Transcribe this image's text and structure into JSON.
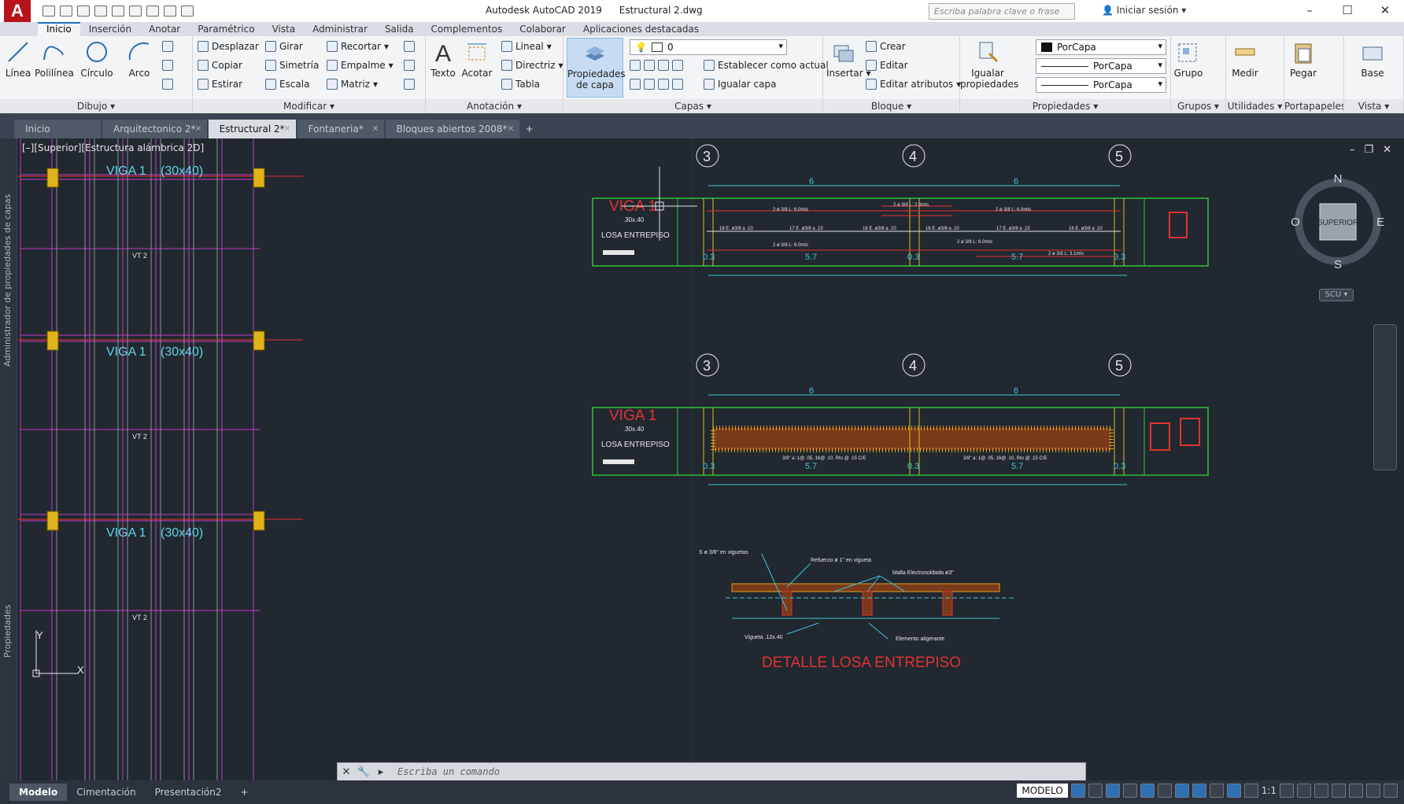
{
  "app": {
    "logo": "A",
    "product": "Autodesk AutoCAD 2019",
    "document": "Estructural 2.dwg",
    "search_placeholder": "Escriba palabra clave o frase",
    "sign_in": "Iniciar sesión",
    "window_controls": [
      "–",
      "☐",
      "✕"
    ]
  },
  "ribbon_tabs": [
    "Inicio",
    "Inserción",
    "Anotar",
    "Paramétrico",
    "Vista",
    "Administrar",
    "Salida",
    "Complementos",
    "Colaborar",
    "Aplicaciones destacadas"
  ],
  "ribbon": {
    "dibujo": {
      "title": "Dibujo",
      "linea": "Línea",
      "polilinea": "Polilínea",
      "circulo": "Círculo",
      "arco": "Arco"
    },
    "modificar": {
      "title": "Modificar",
      "desplazar": "Desplazar",
      "girar": "Girar",
      "recortar": "Recortar",
      "copiar": "Copiar",
      "simetria": "Simetría",
      "empalme": "Empalme",
      "estirar": "Estirar",
      "escala": "Escala",
      "matriz": "Matriz"
    },
    "anotacion": {
      "title": "Anotación",
      "texto": "Texto",
      "acotar": "Acotar",
      "lineal": "Lineal",
      "directriz": "Directriz",
      "tabla": "Tabla"
    },
    "capas": {
      "title": "Capas",
      "propiedades_1": "Propiedades",
      "propiedades_2": "de capa",
      "layer_current": "0",
      "establecer": "Establecer como actual",
      "igualar": "Igualar capa"
    },
    "bloque": {
      "title": "Bloque",
      "insertar": "Insertar",
      "crear": "Crear",
      "editar": "Editar",
      "editar_atributos": "Editar atributos"
    },
    "propiedades": {
      "title": "Propiedades",
      "igualar_1": "Igualar",
      "igualar_2": "propiedades",
      "color": "PorCapa",
      "linetype": "PorCapa",
      "lineweight": "PorCapa"
    },
    "grupos": {
      "title": "Grupos",
      "grupo": "Grupo"
    },
    "utilidades": {
      "title": "Utilidades",
      "medir": "Medir"
    },
    "portapapeles": {
      "title": "Portapapeles",
      "pegar": "Pegar"
    },
    "vista": {
      "title": "Vista",
      "base": "Base"
    }
  },
  "file_tabs": [
    {
      "label": "Inicio"
    },
    {
      "label": "Arquitectonico 2*"
    },
    {
      "label": "Estructural 2*"
    },
    {
      "label": "Fontaneria*"
    },
    {
      "label": "Bloques abiertos 2008*"
    }
  ],
  "viewport": {
    "label": "[–][Superior][Estructura alámbrica 2D]",
    "side_palettes": [
      "Administrador de propiedades de capas",
      "Propiedades"
    ],
    "controls": [
      "–",
      "❐",
      "✕"
    ]
  },
  "drawing": {
    "plan_beam_label": "VIGA 1",
    "plan_beam_size": "(30x40)",
    "plan_vt": "VT 2",
    "axes": [
      "3",
      "4",
      "5"
    ],
    "span_labels": [
      "6",
      "6"
    ],
    "bottom_dims": [
      "0.3",
      "5.7",
      "0.3",
      "5.7",
      "0.3"
    ],
    "beam_title": "VIGA 1",
    "beam_size": ".30x.40",
    "losa": "LOSA ENTREPISO",
    "bar_top": "2 ø 3/8  L: 6.0mts",
    "bar_top_center": "2 ø 3/8  L: 2.0mts",
    "bar_bottom": "2 ø 3/8  L: 6.0mts",
    "bar_end": "2 ø 3/8  L: 3.1mts",
    "stirrups_1": "16 E. ø3/8  a .10",
    "stirrups_2": "17 E. ø3/8  a .15",
    "stirrups_3": "16 E. ø3/8  a .10",
    "stirrup_spec": "3/8\" a: 1@ .05, 16@ .10, Rto @ .15  C/E",
    "detail_title": "DETALLE LOSA ENTREPISO",
    "detail_notes": [
      "S ø 3/8\" en viguetas",
      "Refuerzo ø 1\" en vigueta",
      "Malla Electrosoldada ø3\"",
      "Vigueta .12x.40",
      "Elemento aligerante"
    ]
  },
  "viewcube": {
    "north": "N",
    "south": "S",
    "east": "E",
    "west": "O",
    "face": "SUPERIOR",
    "ucs": "SCU"
  },
  "command_line": {
    "placeholder": "Escriba un comando"
  },
  "layout_tabs": [
    "Modelo",
    "Cimentación",
    "Presentación2"
  ],
  "status": {
    "space": "MODELO",
    "scale": "1:1"
  }
}
